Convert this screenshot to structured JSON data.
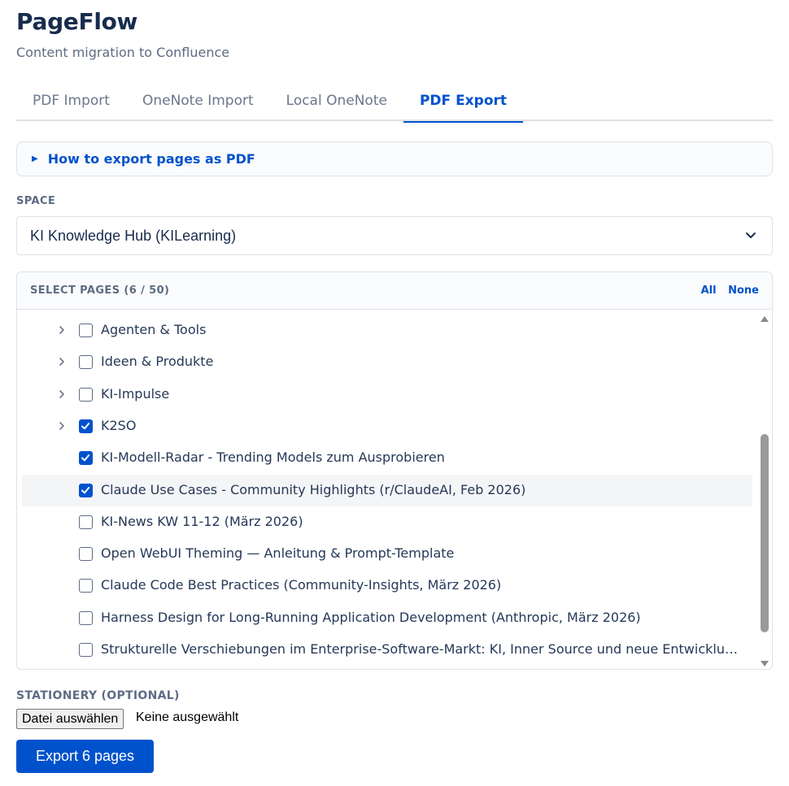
{
  "app": {
    "title": "PageFlow",
    "subtitle": "Content migration to Confluence"
  },
  "tabs": [
    {
      "label": "PDF Import",
      "active": false
    },
    {
      "label": "OneNote Import",
      "active": false
    },
    {
      "label": "Local OneNote",
      "active": false
    },
    {
      "label": "PDF Export",
      "active": true
    }
  ],
  "howto": {
    "label": "How to export pages as PDF",
    "icon": "triangle-right-icon"
  },
  "space": {
    "label": "SPACE",
    "selected": "KI Knowledge Hub (KILearning)",
    "icon": "chevron-down-icon"
  },
  "pages": {
    "header": "SELECT PAGES (6 / 50)",
    "all_label": "All",
    "none_label": "None",
    "items": [
      {
        "label": "Agenten & Tools",
        "checked": false,
        "expandable": true,
        "highlighted": false
      },
      {
        "label": "Ideen & Produkte",
        "checked": false,
        "expandable": true,
        "highlighted": false
      },
      {
        "label": "KI-Impulse",
        "checked": false,
        "expandable": true,
        "highlighted": false
      },
      {
        "label": "K2SO",
        "checked": true,
        "expandable": true,
        "highlighted": false
      },
      {
        "label": "KI-Modell-Radar - Trending Models zum Ausprobieren",
        "checked": true,
        "expandable": false,
        "highlighted": false
      },
      {
        "label": "Claude Use Cases - Community Highlights (r/ClaudeAI, Feb 2026)",
        "checked": true,
        "expandable": false,
        "highlighted": true
      },
      {
        "label": "KI-News KW 11-12 (März 2026)",
        "checked": false,
        "expandable": false,
        "highlighted": false
      },
      {
        "label": "Open WebUI Theming — Anleitung & Prompt-Template",
        "checked": false,
        "expandable": false,
        "highlighted": false
      },
      {
        "label": "Claude Code Best Practices (Community-Insights, März 2026)",
        "checked": false,
        "expandable": false,
        "highlighted": false
      },
      {
        "label": "Harness Design for Long-Running Application Development (Anthropic, März 2026)",
        "checked": false,
        "expandable": false,
        "highlighted": false
      },
      {
        "label": "Strukturelle Verschiebungen im Enterprise-Software-Markt: KI, Inner Source und neue Entwicklungs...",
        "checked": false,
        "expandable": false,
        "highlighted": false
      }
    ]
  },
  "stationery": {
    "label": "STATIONERY (OPTIONAL)",
    "button_label": "Datei auswählen",
    "status": "Keine ausgewählt"
  },
  "export": {
    "label": "Export 6 pages"
  },
  "colors": {
    "accent": "#0052cc",
    "text": "#172b4d",
    "muted": "#5e6c84",
    "border": "#dfe1e6"
  }
}
